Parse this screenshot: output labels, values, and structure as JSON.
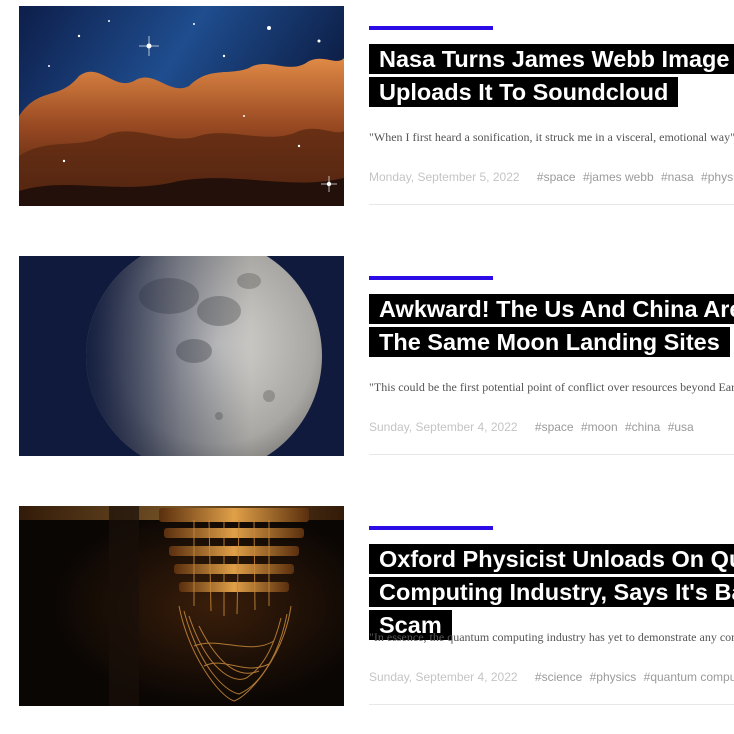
{
  "articles": [
    {
      "image": "nebula-image",
      "title": "Nasa Turns James Webb Image Into Music, Uploads It To Soundcloud",
      "excerpt": "\"When I first heard a sonification, it struck me in a visceral, emotional way\"",
      "date": "Monday, September 5, 2022",
      "tags": [
        "#space",
        "#james webb",
        "#nasa",
        "#physics"
      ]
    },
    {
      "image": "moon-image",
      "title": "Awkward! The Us And China Are Eyeing The Same Moon Landing Sites",
      "excerpt": "\"This could be the first potential point of conflict over resources beyond Earth\"",
      "date": "Sunday, September 4, 2022",
      "tags": [
        "#space",
        "#moon",
        "#china",
        "#usa"
      ]
    },
    {
      "image": "quantum-computer-image",
      "title": "Oxford Physicist Unloads On Quantum Computing Industry, Says It's Basically A Scam",
      "excerpt": "\"In essence, the quantum computing industry has yet to demonstrate any commercial value\"",
      "date": "Sunday, September 4, 2022",
      "tags": [
        "#science",
        "#physics",
        "#quantum computing"
      ]
    }
  ],
  "colors": {
    "accent": "#2c0ce6",
    "title_bg": "#000000",
    "title_text": "#ffffff"
  }
}
